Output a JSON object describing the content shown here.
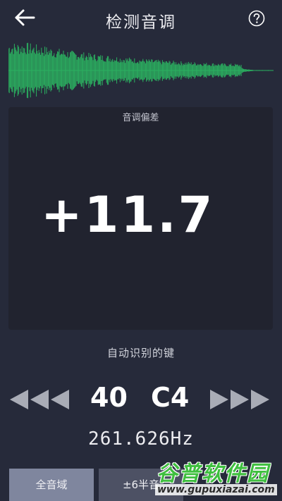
{
  "header": {
    "title": "检测音调",
    "back_icon": "arrow-left-icon",
    "help_icon": "question-circle-icon"
  },
  "waveform": {
    "color": "#2bb160"
  },
  "deviation_panel": {
    "label": "音调偏差",
    "value": "+11.7"
  },
  "key_detection": {
    "label": "自动识别的键",
    "key_number": "40",
    "note": "C4",
    "frequency": "261.626Hz",
    "prev_icon": "triple-triangle-left-icon",
    "next_icon": "triple-triangle-right-icon"
  },
  "range_buttons": {
    "full_range": "全音域",
    "six_semitones": "±6半音"
  },
  "watermark": {
    "title": "谷普软件园",
    "url": "www.gupuxiazai.com"
  },
  "colors": {
    "background": "#262a3a",
    "panel": "#21232f",
    "accent_green": "#2bb160",
    "button_selected": "#7f869e",
    "button_normal": "#4d5164"
  }
}
